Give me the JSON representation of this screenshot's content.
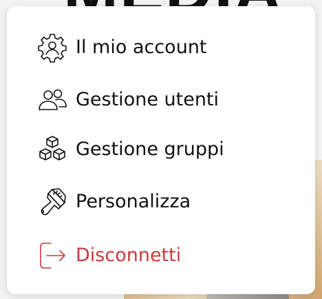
{
  "background": {
    "title_fragment": "MEDIA"
  },
  "menu": {
    "items": [
      {
        "label": "Il mio account",
        "icon": "user-gear-icon"
      },
      {
        "label": "Gestione utenti",
        "icon": "users-icon"
      },
      {
        "label": "Gestione gruppi",
        "icon": "boxes-icon"
      },
      {
        "label": "Personalizza",
        "icon": "paintbrush-icon"
      },
      {
        "label": "Disconnetti",
        "icon": "logout-icon"
      }
    ]
  },
  "colors": {
    "text": "#111111",
    "danger": "#c93a3a",
    "card": "#ffffff"
  }
}
